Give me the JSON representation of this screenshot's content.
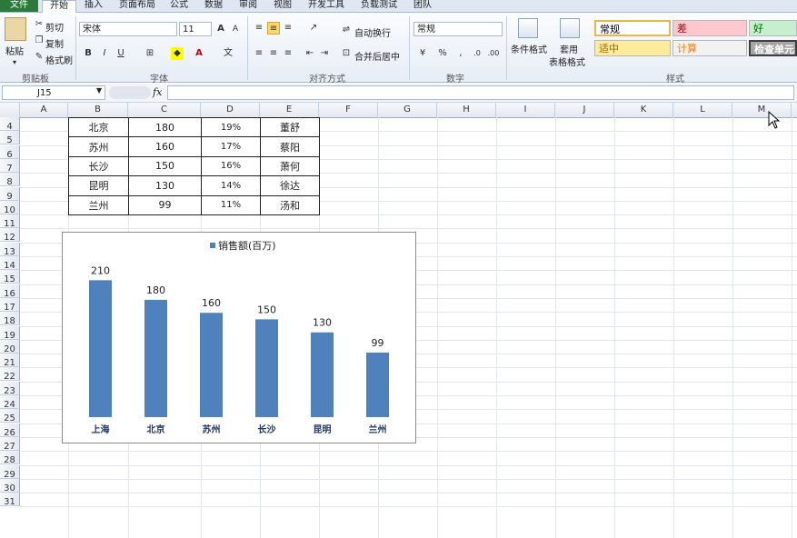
{
  "ribbon_tabs": [
    "文件",
    "开始",
    "插入",
    "页面布局",
    "公式",
    "数据",
    "审阅",
    "视图",
    "开发工具",
    "负载测试",
    "团队"
  ],
  "clipboard": {
    "paste": "粘贴",
    "cut": "剪切",
    "copy": "复制",
    "format_painter": "格式刷",
    "label": "剪贴板"
  },
  "font": {
    "name": "宋体",
    "size": "11",
    "label": "字体"
  },
  "alignment": {
    "wrap": "自动换行",
    "merge": "合并后居中",
    "label": "对齐方式"
  },
  "number": {
    "format": "常规",
    "label": "数字"
  },
  "styles": {
    "conditional": "条件格式",
    "table_format_1": "套用",
    "table_format_2": "表格格式",
    "cells": [
      {
        "text": "常规",
        "bg": "#ffffff",
        "color": "#000000"
      },
      {
        "text": "差",
        "bg": "#ffc7ce",
        "color": "#9c0006"
      },
      {
        "text": "好",
        "bg": "#c6efce",
        "color": "#006100"
      },
      {
        "text": "适中",
        "bg": "#ffeb9c",
        "color": "#9c6500"
      },
      {
        "text": "计算",
        "bg": "#f2f2f2",
        "color": "#fa7d00"
      },
      {
        "text": "检查单元",
        "bg": "#a5a5a5",
        "color": "#ffffff"
      }
    ],
    "label": "样式"
  },
  "formula_bar": {
    "name_box": "J15",
    "fx": "fx",
    "value": ""
  },
  "columns": [
    "A",
    "B",
    "C",
    "D",
    "E",
    "F",
    "G",
    "H",
    "I",
    "J",
    "K",
    "L",
    "M"
  ],
  "rows": [
    "4",
    "5",
    "6",
    "7",
    "8",
    "9",
    "10",
    "11",
    "12",
    "13",
    "14",
    "15",
    "16",
    "17",
    "18",
    "19",
    "20",
    "21",
    "22",
    "23",
    "24",
    "25",
    "26",
    "27",
    "28",
    "29",
    "30",
    "31"
  ],
  "table_rows": [
    [
      "北京",
      "180",
      "19%",
      "董舒"
    ],
    [
      "苏州",
      "160",
      "17%",
      "蔡阳"
    ],
    [
      "长沙",
      "150",
      "16%",
      "萧何"
    ],
    [
      "昆明",
      "130",
      "14%",
      "徐达"
    ],
    [
      "兰州",
      "99",
      "11%",
      "汤和"
    ]
  ],
  "chart_data": {
    "type": "bar",
    "title": "",
    "legend": "top",
    "categories": [
      "上海",
      "北京",
      "苏州",
      "长沙",
      "昆明",
      "兰州"
    ],
    "series": [
      {
        "name": "销售额(百万)",
        "values": [
          210,
          180,
          160,
          150,
          130,
          99
        ],
        "color": "#4f81bd"
      }
    ],
    "ylim": [
      0,
      230
    ],
    "grid": false,
    "data_labels": true
  }
}
